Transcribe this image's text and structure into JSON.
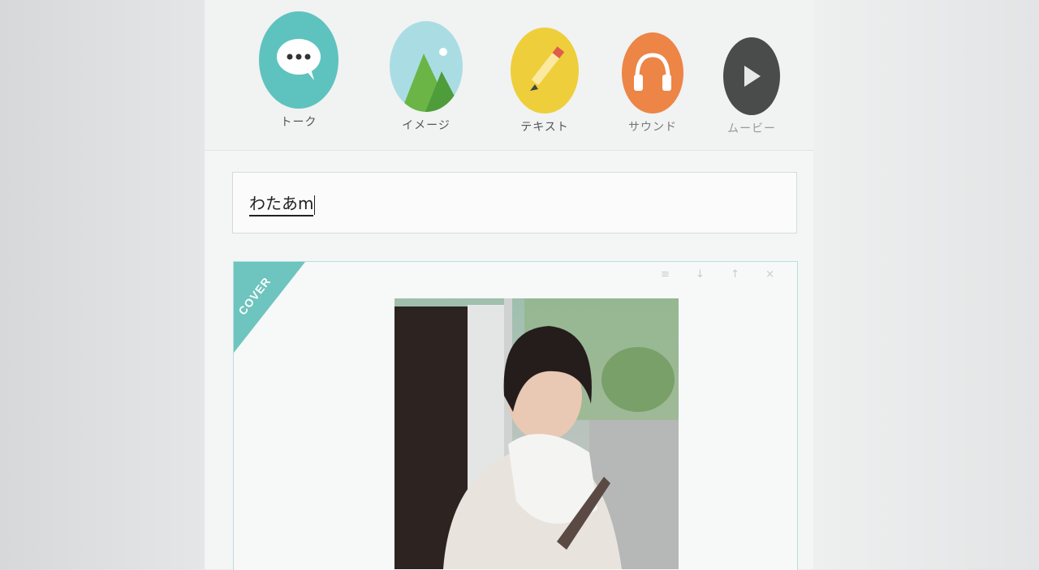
{
  "toolbar": {
    "tools": [
      {
        "label": "トーク",
        "icon": "speech-bubble-icon",
        "color": "#5ec3bf"
      },
      {
        "label": "イメージ",
        "icon": "mountain-icon",
        "color": "#a9dde3"
      },
      {
        "label": "テキスト",
        "icon": "pencil-icon",
        "color": "#eecf3b"
      },
      {
        "label": "サウンド",
        "icon": "headphones-icon",
        "color": "#ec8545"
      },
      {
        "label": "ムービー",
        "icon": "play-icon",
        "color": "#4a4b4b"
      }
    ]
  },
  "editor": {
    "value": "わたあm"
  },
  "card": {
    "badge": "COVER",
    "tools": "≡ ↓ ↑ ×"
  }
}
